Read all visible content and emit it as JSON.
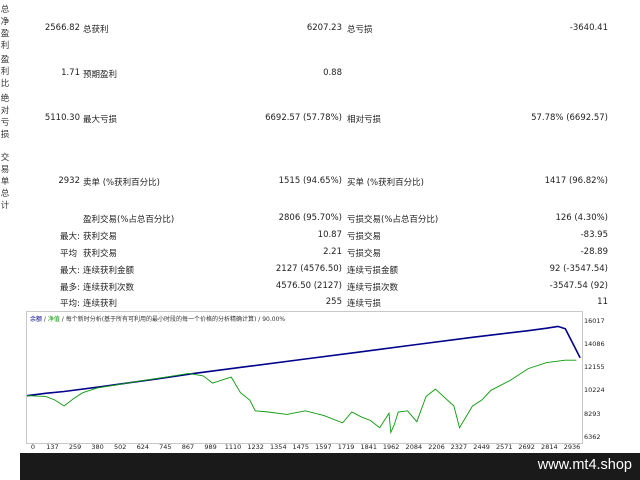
{
  "summary": {
    "side_labels": [
      "总净盈利",
      "盈利比",
      "绝对亏损",
      "交易单总计"
    ],
    "rows": [
      {
        "left_value": "2566.82",
        "mid_label": "总获利",
        "mid_value": "6207.23",
        "right_label": "总亏损",
        "right_value": "-3640.41"
      },
      {
        "left_value": "1.71",
        "mid_label": "预期盈利",
        "mid_value": "0.88",
        "right_label": "",
        "right_value": ""
      },
      {
        "left_value": "5110.30",
        "mid_label": "最大亏损",
        "mid_value": "6692.57 (57.78%)",
        "right_label": "相对亏损",
        "right_value": "57.78% (6692.57)"
      },
      {
        "left_value": "2932",
        "mid_label": "卖单 (%获利百分比)",
        "mid_value": "1515 (94.65%)",
        "right_label": "买单 (%获利百分比)",
        "right_value": "1417 (96.82%)"
      }
    ]
  },
  "trades": [
    {
      "prefix": "",
      "label": "盈利交易(%占总百分比)",
      "value": "2806 (95.70%)",
      "label2": "亏损交易(%占总百分比)",
      "value2": "126 (4.30%)"
    },
    {
      "prefix": "最大:",
      "label": "获利交易",
      "value": "10.87",
      "label2": "亏损交易",
      "value2": "-83.95"
    },
    {
      "prefix": "平均",
      "label": "获利交易",
      "value": "2.21",
      "label2": "亏损交易",
      "value2": "-28.89"
    },
    {
      "prefix": "最大:",
      "label": "连续获利金额",
      "value": "2127 (4576.50)",
      "label2": "连续亏损金额",
      "value2": "92 (-3547.54)"
    },
    {
      "prefix": "最多:",
      "label": "连续获利次数",
      "value": "4576.50 (2127)",
      "label2": "连续亏损次数",
      "value2": "-3547.54 (92)"
    },
    {
      "prefix": "平均:",
      "label": "连续获利",
      "value": "255",
      "label2": "连续亏损",
      "value2": "11"
    }
  ],
  "chart_legend": {
    "balance": "余额",
    "equity": "净值",
    "note": "每个新时分析(基于所有可利用的最小时段的每一个价格的分析精确计算) / 90.00%"
  },
  "colors": {
    "balance": "#00008b",
    "equity": "#0a9a0a"
  },
  "chart_data": {
    "type": "line",
    "series": [
      {
        "name": "余额",
        "x": [
          0,
          100,
          200,
          400,
          700,
          900,
          1200,
          1500,
          1800,
          2100,
          2400,
          2700,
          2800,
          2860,
          2900,
          2950,
          2980
        ],
        "y": [
          9950,
          10150,
          10300,
          10700,
          11350,
          11800,
          12400,
          13000,
          13600,
          14200,
          14800,
          15350,
          15550,
          15700,
          15500,
          14000,
          13100
        ]
      },
      {
        "name": "净值",
        "x": [
          0,
          100,
          150,
          200,
          250,
          300,
          380,
          500,
          620,
          750,
          870,
          950,
          1000,
          1100,
          1150,
          1200,
          1230,
          1300,
          1400,
          1500,
          1600,
          1700,
          1750,
          1800,
          1850,
          1900,
          1950,
          1960,
          1980,
          2000,
          2050,
          2100,
          2150,
          2200,
          2300,
          2330,
          2400,
          2450,
          2500,
          2600,
          2700,
          2800,
          2900,
          2960
        ],
        "y": [
          9950,
          9900,
          9600,
          9100,
          9700,
          10200,
          10600,
          10900,
          11200,
          11500,
          11800,
          11600,
          11000,
          11500,
          10200,
          9600,
          8700,
          8600,
          8400,
          8700,
          8300,
          7700,
          8600,
          8200,
          7900,
          7300,
          8500,
          6900,
          7600,
          8600,
          8700,
          7800,
          9900,
          10500,
          9100,
          7300,
          9100,
          9600,
          10400,
          11200,
          12200,
          12700,
          12900,
          12900
        ]
      }
    ],
    "xticks": [
      0,
      137,
      259,
      380,
      502,
      624,
      745,
      867,
      989,
      1110,
      1232,
      1354,
      1475,
      1597,
      1719,
      1841,
      1962,
      2084,
      2206,
      2327,
      2449,
      2571,
      2692,
      2814,
      2936
    ],
    "yticks": [
      16017,
      14086,
      12155,
      10224,
      8293,
      6362
    ],
    "ylim": [
      6362,
      16400
    ],
    "xlim": [
      0,
      2990
    ]
  }
}
